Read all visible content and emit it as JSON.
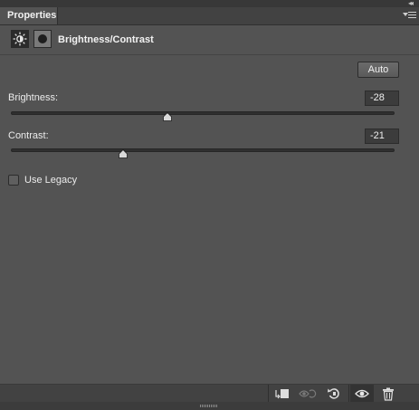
{
  "panel": {
    "tab_label": "Properties",
    "title": "Brightness/Contrast",
    "auto_label": "Auto"
  },
  "brightness": {
    "label": "Brightness:",
    "value": "-28",
    "range": [
      -150,
      150
    ]
  },
  "contrast": {
    "label": "Contrast:",
    "value": "-21",
    "range": [
      -50,
      100
    ]
  },
  "legacy": {
    "label": "Use Legacy",
    "checked": false
  },
  "icons": {
    "panel_collapse": "double-chevron-right-icon",
    "panel_menu": "panel-menu-icon",
    "adjustment": "brightness-contrast-icon",
    "mask": "layer-mask-icon",
    "clip": "clip-to-layer-icon",
    "view_previous": "view-previous-state-icon",
    "reset": "reset-icon",
    "visibility": "eye-icon",
    "delete": "trash-icon"
  },
  "colors": {
    "panel_bg": "#535353",
    "toolbar_bg": "#424242",
    "field_bg": "#3c3c3c"
  }
}
